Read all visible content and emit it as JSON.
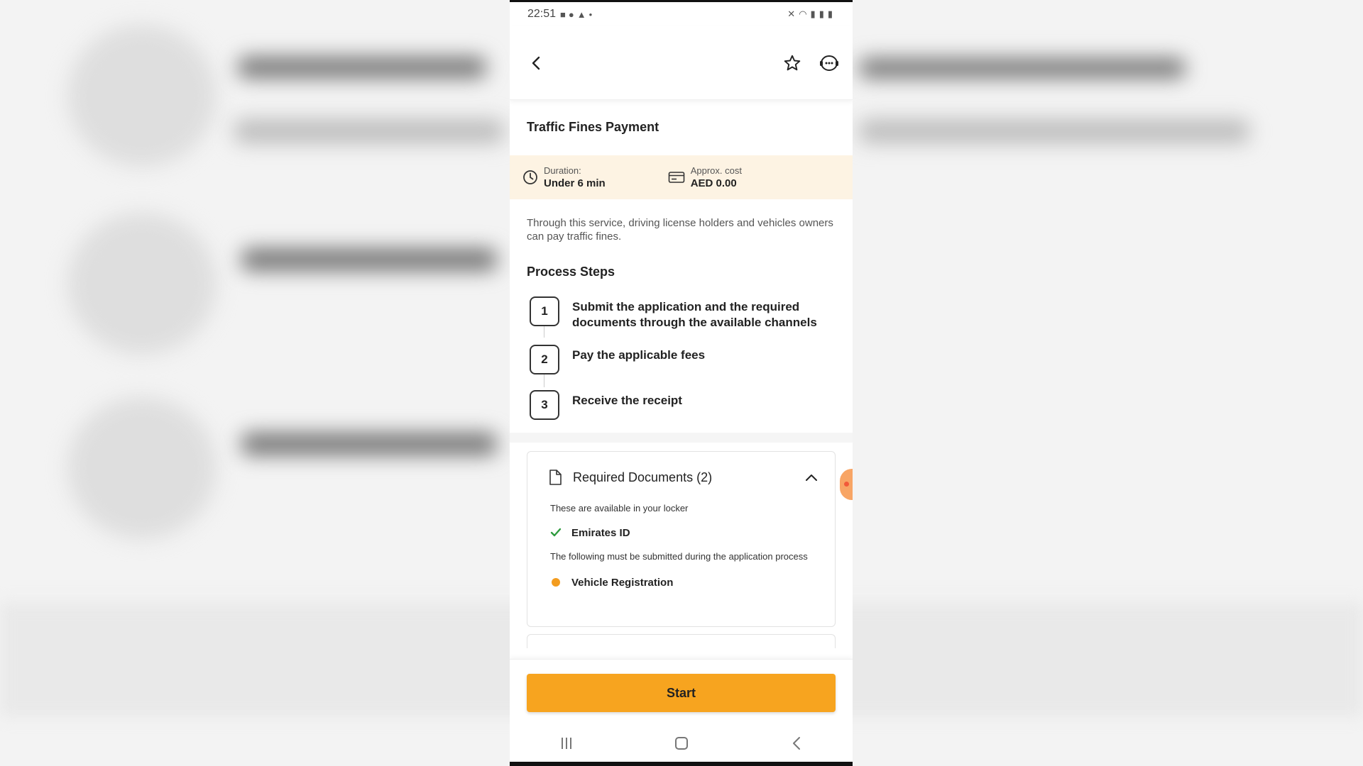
{
  "status_bar": {
    "time": "22:51",
    "notif_icons": [
      "video-icon",
      "facebook-icon",
      "upload-icon"
    ],
    "dot": "•",
    "system_icons": [
      "mute-icon",
      "wifi-icon",
      "signal-icon",
      "signal2-icon",
      "battery-icon"
    ]
  },
  "header": {
    "back_icon": "back-arrow-icon",
    "favorite_icon": "star-icon",
    "chat_icon": "chat-support-icon"
  },
  "service": {
    "title": "Traffic Fines Payment",
    "duration_label": "Duration:",
    "duration_value": "Under 6 min",
    "cost_label": "Approx. cost",
    "cost_value": "AED 0.00",
    "description": "Through this service, driving license holders and vehicles owners can pay traffic fines."
  },
  "process": {
    "title": "Process Steps",
    "steps": [
      {
        "num": "1",
        "text": "Submit the application and the required documents through the available channels"
      },
      {
        "num": "2",
        "text": "Pay the applicable fees"
      },
      {
        "num": "3",
        "text": "Receive the receipt"
      }
    ]
  },
  "documents": {
    "title": "Required Documents (2)",
    "locker_note": "These are available in your locker",
    "locker_items": [
      "Emirates ID"
    ],
    "submit_note": "The following must be submitted during the application process",
    "submit_items": [
      "Vehicle Registration"
    ]
  },
  "actions": {
    "start_label": "Start"
  },
  "colors": {
    "accent": "#f7a41f",
    "info_strip_bg": "#fdf3e3",
    "check_green": "#2e9b3e",
    "pending_orange": "#f39c1f"
  }
}
